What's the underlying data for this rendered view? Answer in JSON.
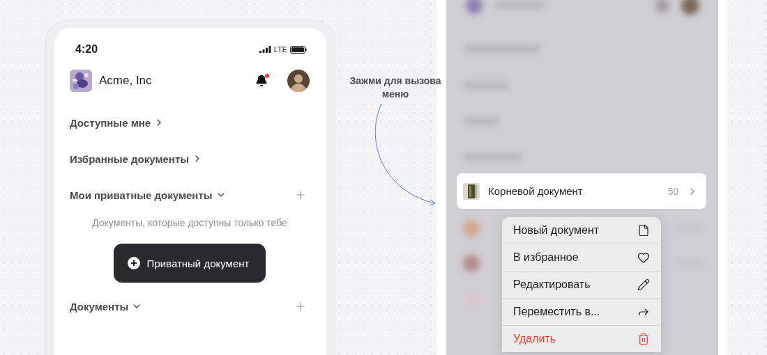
{
  "status_bar": {
    "time": "4:20",
    "network": "LTE"
  },
  "header": {
    "workspace": "Acme, Inc",
    "unread": true
  },
  "sections": [
    {
      "title": "Доступные мне",
      "expanded": false,
      "addable": false
    },
    {
      "title": "Избранные документы",
      "expanded": false,
      "addable": false
    },
    {
      "title": "Мои приватные документы",
      "expanded": true,
      "addable": true,
      "empty_text": "Документы, которые доступны только тебе",
      "button": "Приватный документ"
    },
    {
      "title": "Документы",
      "expanded": true,
      "addable": true
    }
  ],
  "annotation": "Зажми для вызова меню",
  "focused_document": {
    "title": "Корневой документ",
    "count": "50"
  },
  "context_menu": [
    {
      "label": "Новый документ",
      "kind": "normal"
    },
    {
      "label": "В избранное",
      "kind": "normal"
    },
    {
      "label": "Редактировать",
      "kind": "normal"
    },
    {
      "label": "Переместить в...",
      "kind": "normal"
    },
    {
      "label": "Удалить",
      "kind": "destructive"
    }
  ]
}
